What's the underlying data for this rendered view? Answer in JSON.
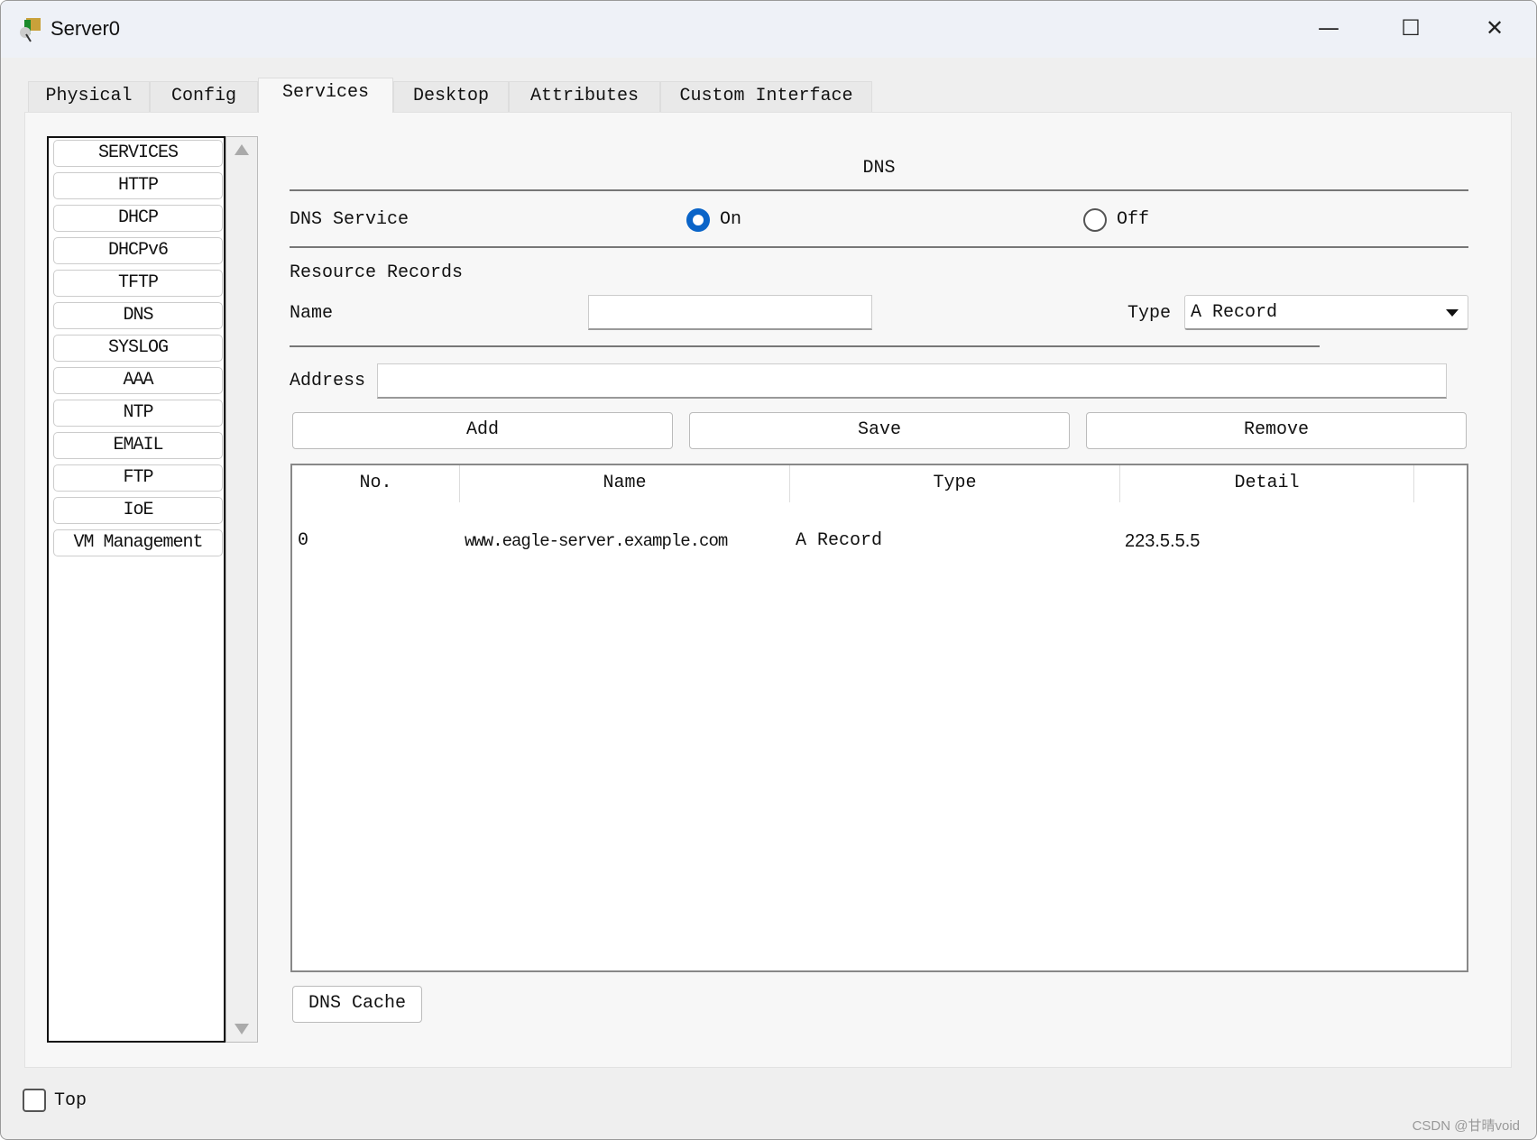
{
  "window": {
    "title": "Server0",
    "minimize": "—",
    "maximize": "☐",
    "close": "✕"
  },
  "tabs": [
    {
      "label": "Physical"
    },
    {
      "label": "Config"
    },
    {
      "label": "Services",
      "active": true
    },
    {
      "label": "Desktop"
    },
    {
      "label": "Attributes"
    },
    {
      "label": "Custom Interface"
    }
  ],
  "sidebar": {
    "items": [
      {
        "label": "SERVICES"
      },
      {
        "label": "HTTP"
      },
      {
        "label": "DHCP"
      },
      {
        "label": "DHCPv6"
      },
      {
        "label": "TFTP"
      },
      {
        "label": "DNS"
      },
      {
        "label": "SYSLOG"
      },
      {
        "label": "AAA"
      },
      {
        "label": "NTP"
      },
      {
        "label": "EMAIL"
      },
      {
        "label": "FTP"
      },
      {
        "label": "IoE"
      },
      {
        "label": "VM Management"
      }
    ]
  },
  "dns": {
    "title": "DNS",
    "service_label": "DNS Service",
    "on_label": "On",
    "off_label": "Off",
    "service_state": "On",
    "resource_records_label": "Resource Records",
    "name_label": "Name",
    "name_value": "",
    "type_label": "Type",
    "type_value": "A Record",
    "address_label": "Address",
    "address_value": "",
    "add_label": "Add",
    "save_label": "Save",
    "remove_label": "Remove",
    "table": {
      "headers": [
        "No.",
        "Name",
        "Type",
        "Detail"
      ],
      "rows": [
        {
          "no": "0",
          "name": "www.eagle-server.example.com",
          "type": "A Record",
          "detail": "223.5.5.5"
        }
      ]
    },
    "cache_label": "DNS Cache"
  },
  "footer": {
    "top_label": "Top",
    "top_checked": false
  },
  "watermark": "CSDN @甘晴void",
  "colors": {
    "accent": "#0a64c8"
  }
}
